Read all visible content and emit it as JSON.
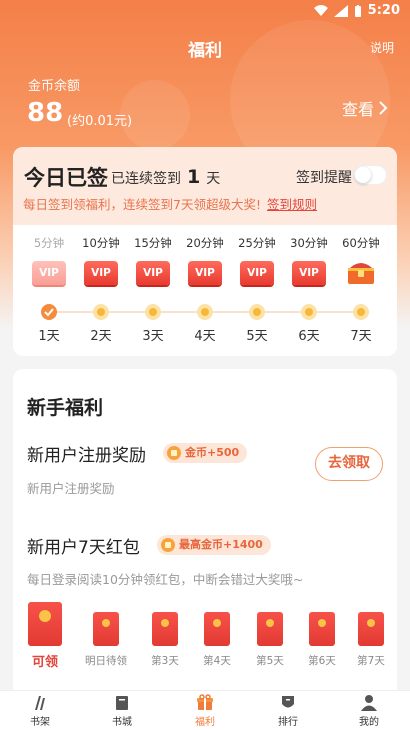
{
  "status_bar": {
    "time": "5:20"
  },
  "nav": {
    "title": "福利",
    "help": "说明"
  },
  "coins": {
    "label": "金币余额",
    "amount": "88",
    "approx": "(约0.01元)",
    "view": "查看"
  },
  "checkin": {
    "title": "今日已签",
    "streak_prefix": "已连续签到",
    "streak_days": "1",
    "streak_unit": "天",
    "remind_label": "签到提醒",
    "desc": "每日签到领福利，连续签到7天领超级大奖!",
    "rule_link": "签到规则",
    "days": [
      {
        "minutes": "5分钟",
        "reward": "VIP",
        "label": "1天",
        "done": true
      },
      {
        "minutes": "10分钟",
        "reward": "VIP",
        "label": "2天",
        "done": false
      },
      {
        "minutes": "15分钟",
        "reward": "VIP",
        "label": "3天",
        "done": false
      },
      {
        "minutes": "20分钟",
        "reward": "VIP",
        "label": "4天",
        "done": false
      },
      {
        "minutes": "25分钟",
        "reward": "VIP",
        "label": "5天",
        "done": false
      },
      {
        "minutes": "30分钟",
        "reward": "VIP",
        "label": "6天",
        "done": false
      },
      {
        "minutes": "60分钟",
        "reward": "treasure-chest-icon",
        "label": "7天",
        "done": false
      }
    ]
  },
  "newbie": {
    "title": "新手福利",
    "register": {
      "title": "新用户注册奖励",
      "tag": "金币+500",
      "desc": "新用户注册奖励",
      "button": "去领取"
    },
    "redpack": {
      "title": "新用户7天红包",
      "tag": "最高金币+1400",
      "desc": "每日登录阅读10分钟领红包，中断会错过大奖哦~",
      "days": [
        {
          "label": "可领",
          "active": true
        },
        {
          "label": "明日待领",
          "active": false
        },
        {
          "label": "第3天",
          "active": false
        },
        {
          "label": "第4天",
          "active": false
        },
        {
          "label": "第5天",
          "active": false
        },
        {
          "label": "第6天",
          "active": false
        },
        {
          "label": "第7天",
          "active": false
        }
      ]
    }
  },
  "tabs": [
    {
      "label": "书架",
      "icon": "bookshelf-icon"
    },
    {
      "label": "书城",
      "icon": "bookstore-icon"
    },
    {
      "label": "福利",
      "icon": "gift-icon",
      "active": true
    },
    {
      "label": "排行",
      "icon": "ranking-icon"
    },
    {
      "label": "我的",
      "icon": "profile-icon"
    }
  ],
  "colors": {
    "accent": "#f17b3a",
    "red": "#e2453c",
    "header": "#f47f48"
  }
}
